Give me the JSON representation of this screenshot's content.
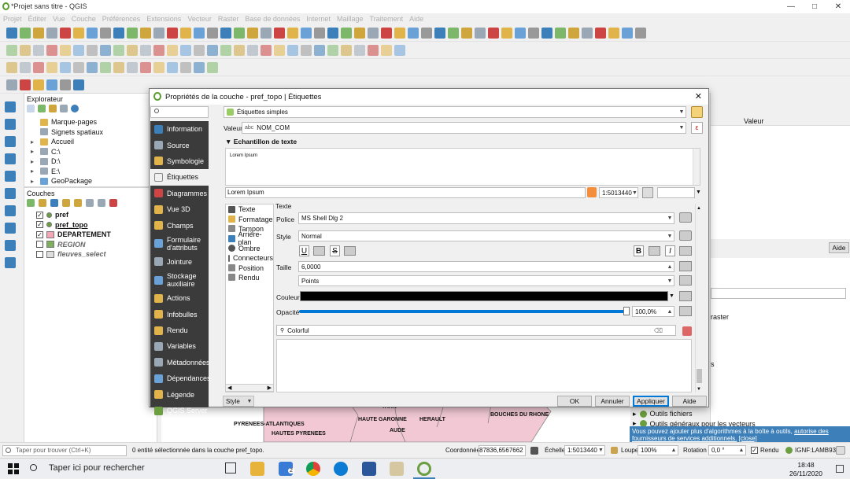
{
  "window": {
    "title": "*Projet sans titre - QGIS"
  },
  "menu": [
    "Projet",
    "Éditer",
    "Vue",
    "Couche",
    "Préférences",
    "Extensions",
    "Vecteur",
    "Raster",
    "Base de données",
    "Internet",
    "Maillage",
    "Traitement",
    "Aide"
  ],
  "explorer": {
    "title": "Explorateur",
    "items": [
      "Marque-pages",
      "Signets spatiaux",
      "Accueil",
      "C:\\",
      "D:\\",
      "E:\\",
      "GeoPackage"
    ]
  },
  "layers": {
    "title": "Couches",
    "items": [
      "pref",
      "pref_topo",
      "DEPARTEMENT",
      "REGION",
      "fleuves_select"
    ]
  },
  "right_panel": {
    "header": "Valeur",
    "item": "raster",
    "list": [
      "Outils fichiers",
      "Outils généraux pour les vecteurs"
    ],
    "banner": "Vous pouvez ajouter plus d'algorithmes à la boîte à outils,",
    "banner_link": "autorise des fournisseurs de services additionnels.",
    "banner_close": "[close]",
    "aide": "Aide"
  },
  "map_labels": [
    "PYRENEES-ATLANTIQUES",
    "HAUTES PYRENEES",
    "TARN",
    "HAUTE GARONNE",
    "AUDE",
    "HERAULT",
    "BOUCHES DU RHONE"
  ],
  "status": {
    "search_placeholder": "Taper pour trouver (Ctrl+K)",
    "message": "0 entité sélectionnée dans la couche pref_topo.",
    "coord_label": "Coordonnée",
    "coord_value": "87836,6567662",
    "scale_label": "Échelle",
    "scale_value": "1:5013440",
    "magnifier_label": "Loupe",
    "magnifier_value": "100%",
    "rotation_label": "Rotation",
    "rotation_value": "0,0 °",
    "render_label": "Rendu",
    "crs": "IGNF:LAMB93"
  },
  "taskbar": {
    "search": "Taper ici pour rechercher",
    "time": "18:48",
    "date": "26/11/2020",
    "mail_count": "2"
  },
  "dialog": {
    "title": "Propriétés de la couche - pref_topo | Étiquettes",
    "nav": [
      "Information",
      "Source",
      "Symbologie",
      "Étiquettes",
      "Diagrammes",
      "Vue 3D",
      "Champs",
      "Formulaire d'attributs",
      "Jointure",
      "Stockage auxiliaire",
      "Actions",
      "Infobulles",
      "Rendu",
      "Variables",
      "Métadonnées",
      "Dépendances",
      "Légende",
      "QGIS Server"
    ],
    "label_mode": "Étiquettes simples",
    "valeur_label": "Valeur",
    "valeur_field": "NOM_COM",
    "sample_title": "Echantillon de texte",
    "sample_text": "Lorem Ipsum",
    "sample_input": "Lorem Ipsum",
    "scale": "1:5013440",
    "style_btn": "Style",
    "tabs": [
      "Texte",
      "Formatage",
      "Tampon",
      "Arrière-plan",
      "Ombre",
      "Connecteurs",
      "Position",
      "Rendu"
    ],
    "texte_header": "Texte",
    "police_label": "Police",
    "police_value": "MS Shell Dlg 2",
    "style_label": "Style",
    "style_value": "Normal",
    "taille_label": "Taille",
    "taille_value": "6,0000",
    "unit_value": "Points",
    "couleur_label": "Couleur",
    "opacite_label": "Opacité",
    "opacite_value": "100,0%",
    "opacity": 1.0,
    "colorful": "Colorful",
    "ok": "OK",
    "annuler": "Annuler",
    "appliquer": "Appliquer",
    "aide": "Aide",
    "colors": {
      "nav_bg": "#3b3b3b",
      "accent": "#0078d7",
      "text_color": "#000000"
    }
  }
}
